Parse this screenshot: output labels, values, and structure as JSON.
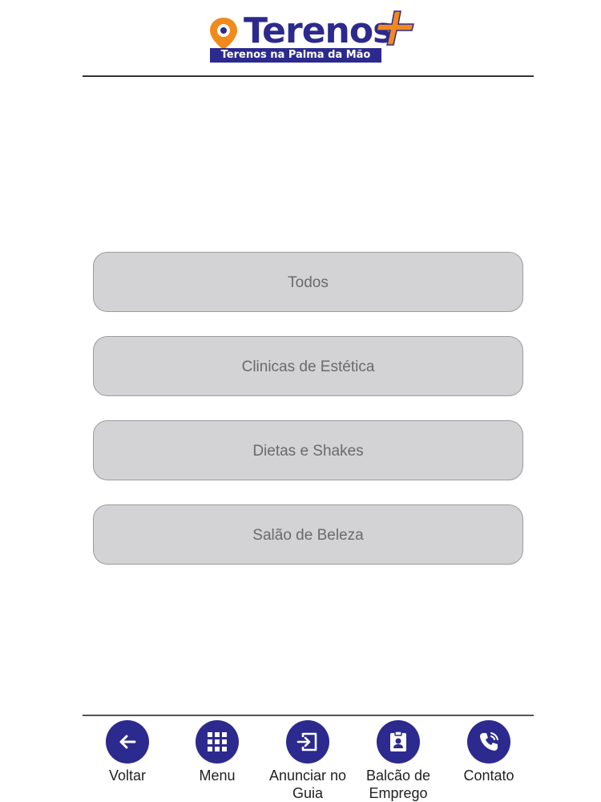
{
  "header": {
    "logo_word": "Terenos",
    "logo_tagline": "Terenos na Palma da Mão",
    "icons": {
      "pin": "location-pin-icon",
      "plus": "plus-icon"
    }
  },
  "categories": [
    {
      "label": "Todos"
    },
    {
      "label": "Clinicas de Estética"
    },
    {
      "label": "Dietas e Shakes"
    },
    {
      "label": "Salão de Beleza"
    }
  ],
  "bottom_nav": [
    {
      "label": "Voltar",
      "icon": "arrow-left-icon"
    },
    {
      "label": "Menu",
      "icon": "grid-icon"
    },
    {
      "label_line1": "Anunciar no",
      "label_line2": "Guia",
      "icon": "exit-to-app-icon"
    },
    {
      "label_line1": "Balcão de",
      "label_line2": "Emprego",
      "icon": "badge-icon"
    },
    {
      "label": "Contato",
      "icon": "phone-icon"
    }
  ],
  "colors": {
    "brand_blue": "#2c2a8e",
    "brand_orange": "#f18a1d",
    "button_fill": "#d3d2d4",
    "button_text": "#6a6a6a"
  }
}
